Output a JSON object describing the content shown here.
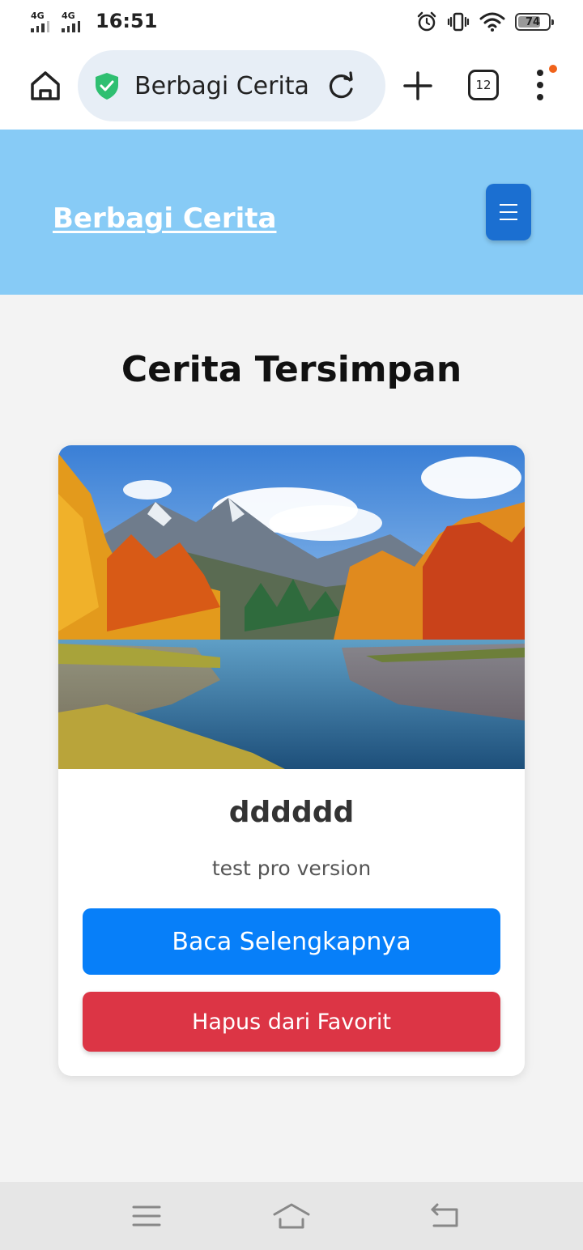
{
  "status_bar": {
    "network_1": "4G",
    "network_2": "4G",
    "time": "16:51",
    "battery": "74",
    "battery_level": 0.74
  },
  "browser": {
    "url_title": "Berbagi Cerita",
    "tab_count": "12"
  },
  "header": {
    "brand": "Berbagi Cerita"
  },
  "page": {
    "title": "Cerita Tersimpan"
  },
  "story": {
    "title": "dddddd",
    "description": "test pro version",
    "read_label": "Baca Selengkapnya",
    "remove_label": "Hapus dari Favorit"
  },
  "colors": {
    "header_bg": "#87cbf6",
    "menu_button": "#1b6fd1",
    "primary": "#077ff9",
    "danger": "#dc3545"
  }
}
